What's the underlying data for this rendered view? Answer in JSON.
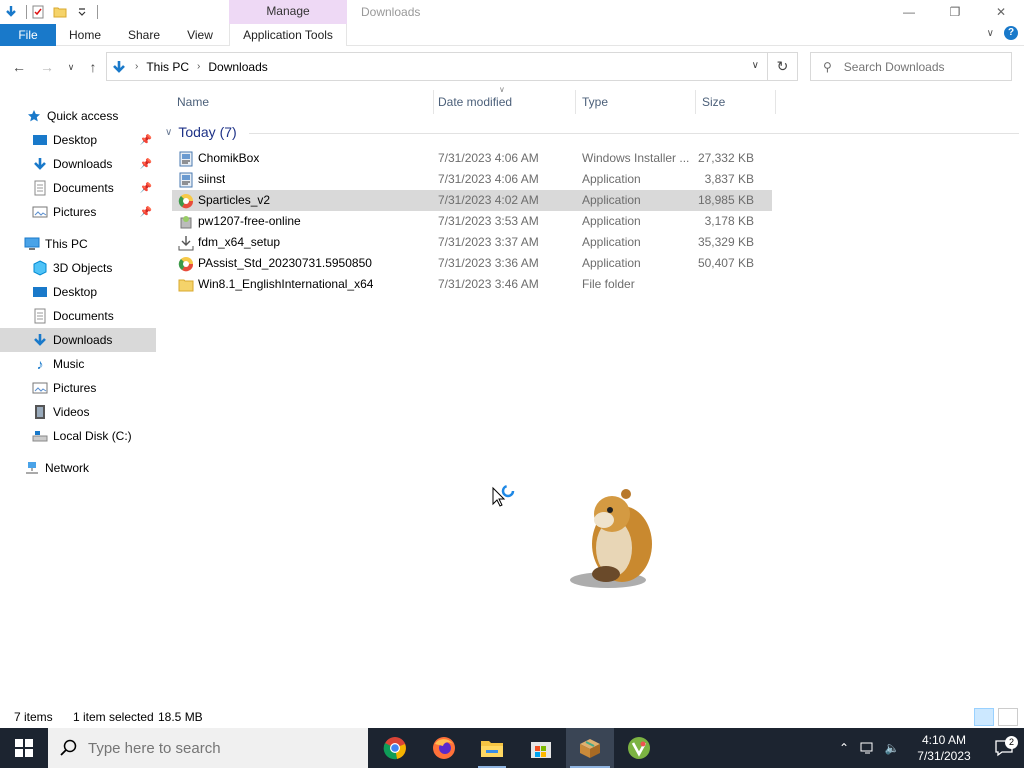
{
  "window": {
    "title": "Downloads",
    "context_tab": "Manage"
  },
  "ribbon": {
    "tabs": [
      "File",
      "Home",
      "Share",
      "View",
      "Application Tools"
    ]
  },
  "address": {
    "crumbs": [
      "This PC",
      "Downloads"
    ]
  },
  "search": {
    "placeholder": "Search Downloads"
  },
  "nav": {
    "quick_access": "Quick access",
    "qa_items": [
      "Desktop",
      "Downloads",
      "Documents",
      "Pictures"
    ],
    "this_pc": "This PC",
    "pc_items": [
      "3D Objects",
      "Desktop",
      "Documents",
      "Downloads",
      "Music",
      "Pictures",
      "Videos",
      "Local Disk (C:)"
    ],
    "network": "Network",
    "selected": "Downloads"
  },
  "columns": {
    "name": "Name",
    "date": "Date modified",
    "type": "Type",
    "size": "Size"
  },
  "group": {
    "label": "Today (7)"
  },
  "files": [
    {
      "name": "ChomikBox",
      "date": "7/31/2023 4:06 AM",
      "type": "Windows Installer ...",
      "size": "27,332 KB",
      "icon": "installer-icon"
    },
    {
      "name": "siinst",
      "date": "7/31/2023 4:06 AM",
      "type": "Application",
      "size": "3,837 KB",
      "icon": "installer-icon"
    },
    {
      "name": "Sparticles_v2",
      "date": "7/31/2023 4:02 AM",
      "type": "Application",
      "size": "18,985 KB",
      "icon": "app-icon",
      "selected": true
    },
    {
      "name": "pw1207-free-online",
      "date": "7/31/2023 3:53 AM",
      "type": "Application",
      "size": "3,178 KB",
      "icon": "setup-icon"
    },
    {
      "name": "fdm_x64_setup",
      "date": "7/31/2023 3:37 AM",
      "type": "Application",
      "size": "35,329 KB",
      "icon": "download-setup-icon"
    },
    {
      "name": "PAssist_Std_20230731.5950850",
      "date": "7/31/2023 3:36 AM",
      "type": "Application",
      "size": "50,407 KB",
      "icon": "app-icon"
    },
    {
      "name": "Win8.1_EnglishInternational_x64",
      "date": "7/31/2023 3:46 AM",
      "type": "File folder",
      "size": "",
      "icon": "folder-icon"
    }
  ],
  "status": {
    "items": "7 items",
    "selected": "1 item selected",
    "size": "18.5 MB"
  },
  "taskbar": {
    "search_placeholder": "Type here to search",
    "time": "4:10 AM",
    "date": "7/31/2023",
    "notifications": "2"
  }
}
